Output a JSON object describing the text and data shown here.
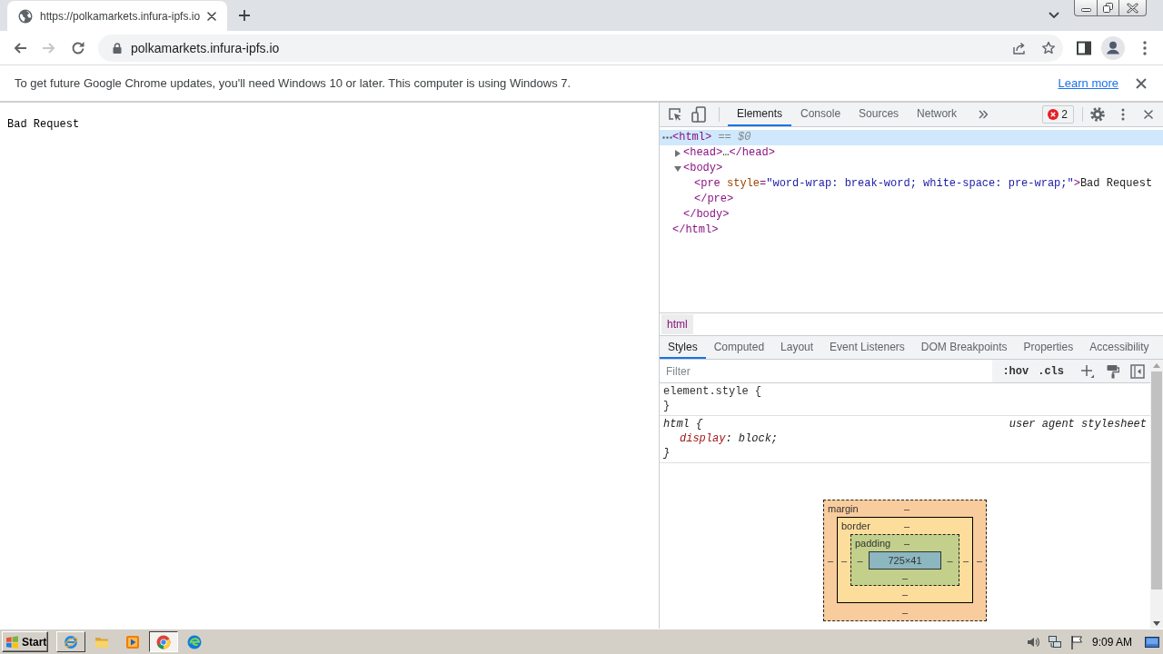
{
  "browser": {
    "tabs": [
      {
        "title": "https://polkamarkets.infura-ipfs.io",
        "selected": true
      }
    ],
    "nav_buttons": [
      {
        "kind": "back",
        "disabled": false
      },
      {
        "kind": "forward",
        "disabled": true
      },
      {
        "kind": "reload",
        "disabled": false
      }
    ],
    "address": "polkamarkets.infura-ipfs.io"
  },
  "infobar": {
    "message": "To get future Google Chrome updates, you'll need Windows 10 or later. This computer is using Windows 7.",
    "link": "Learn more"
  },
  "page": {
    "text": "Bad Request"
  },
  "devtools": {
    "tabs": [
      {
        "label": "Elements",
        "selected": true
      },
      {
        "label": "Console",
        "selected": false
      },
      {
        "label": "Sources",
        "selected": false
      },
      {
        "label": "Network",
        "selected": false
      }
    ],
    "error_count": "2",
    "dom_tree": [
      {
        "selected": true,
        "parts": [
          {
            "kind": "tag",
            "text": "<html>"
          },
          {
            "kind": "marker",
            "text": " == $0"
          }
        ],
        "children": [
          {
            "selected": false,
            "expanded": false,
            "parts": [
              {
                "kind": "tag",
                "text": "<head>"
              },
              {
                "kind": "plain",
                "text": "…"
              },
              {
                "kind": "tag",
                "text": "</head>"
              }
            ]
          },
          {
            "selected": false,
            "expanded": true,
            "parts": [
              {
                "kind": "tag",
                "text": "<body>"
              }
            ],
            "children": [
              {
                "selected": false,
                "parts": [
                  {
                    "kind": "tag",
                    "text": "<pre "
                  },
                  {
                    "kind": "attr_name",
                    "text": "style"
                  },
                  {
                    "kind": "tag",
                    "text": "="
                  },
                  {
                    "kind": "attr_value",
                    "text": "\"word-wrap: break-word; white-space: pre-wrap;\""
                  },
                  {
                    "kind": "tag",
                    "text": ">"
                  },
                  {
                    "kind": "plain",
                    "text": "Bad Request"
                  }
                ],
                "close": [
                  {
                    "kind": "tag",
                    "text": "</pre>"
                  }
                ]
              }
            ],
            "close": [
              {
                "kind": "tag",
                "text": "</body>"
              }
            ]
          }
        ],
        "close": [
          {
            "kind": "tag",
            "text": "</html>"
          }
        ]
      }
    ],
    "breadcrumb": "html",
    "sidebar_tabs": [
      {
        "label": "Styles",
        "selected": true
      },
      {
        "label": "Computed",
        "selected": false
      },
      {
        "label": "Layout",
        "selected": false
      },
      {
        "label": "Event Listeners",
        "selected": false
      },
      {
        "label": "DOM Breakpoints",
        "selected": false
      },
      {
        "label": "Properties",
        "selected": false
      },
      {
        "label": "Accessibility",
        "selected": false
      }
    ],
    "filter": {
      "placeholder": "Filter"
    },
    "filter_toggles": [
      ":hov",
      ".cls"
    ],
    "rules": [
      {
        "selector": "element.style {",
        "user_agent": false,
        "close": "}"
      },
      {
        "selector": "html {",
        "user_agent": true,
        "source": "user agent stylesheet",
        "declarations": [
          [
            {
              "kind": "property",
              "text": "display"
            },
            {
              "kind": "plain",
              "text": ": block;"
            }
          ]
        ],
        "close": "}"
      }
    ],
    "box_model": {
      "layers": [
        {
          "kind": "margin",
          "label": "margin",
          "top": "–",
          "left": "–"
        },
        {
          "kind": "border",
          "label": "border",
          "top": "–",
          "left": "–"
        },
        {
          "kind": "padding",
          "label": "padding",
          "top": "–",
          "left": "–"
        }
      ],
      "content": "725×41",
      "sides_inner_first": [
        {
          "right": "–",
          "bottom": "–"
        },
        {
          "right": "–",
          "bottom": "–"
        },
        {
          "right": "–",
          "bottom": "–"
        }
      ]
    }
  },
  "taskbar": {
    "start": "Start",
    "apps": [
      {
        "kind": "e_logo",
        "running": true,
        "selected": false
      },
      {
        "kind": "folder",
        "running": false,
        "selected": false
      },
      {
        "kind": "player",
        "running": false,
        "selected": false
      },
      {
        "kind": "round_logo",
        "running": true,
        "selected": true
      },
      {
        "kind": "swirl_logo",
        "running": false,
        "selected": false
      }
    ],
    "clock": "9:09 AM"
  }
}
